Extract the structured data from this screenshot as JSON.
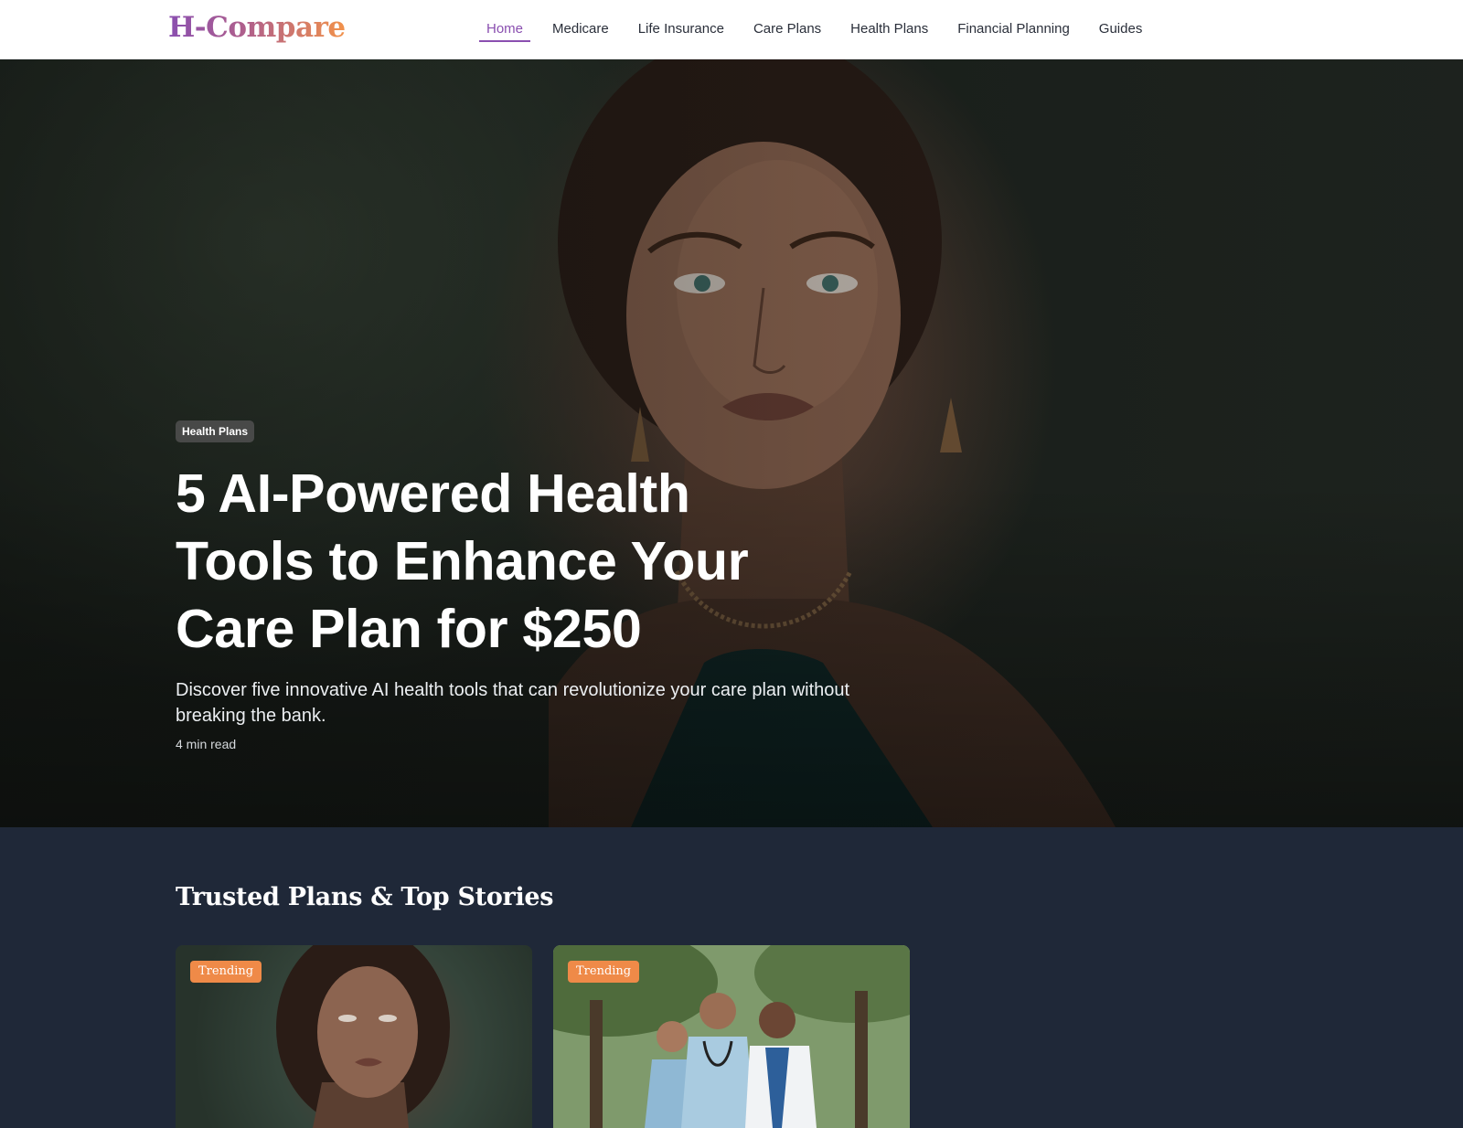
{
  "header": {
    "logo": "H-Compare",
    "nav": [
      {
        "label": "Home",
        "active": true
      },
      {
        "label": "Medicare"
      },
      {
        "label": "Life Insurance"
      },
      {
        "label": "Care Plans"
      },
      {
        "label": "Health Plans"
      },
      {
        "label": "Financial Planning"
      },
      {
        "label": "Guides"
      }
    ]
  },
  "hero": {
    "category": "Health Plans",
    "title": "5 AI-Powered Health Tools to Enhance Your Care Plan for $250",
    "subtitle": "Discover five innovative AI health tools that can revolutionize your care plan without breaking the bank.",
    "read_time": "4 min read"
  },
  "section": {
    "title": "Trusted Plans & Top Stories",
    "cards": [
      {
        "tag": "Trending"
      },
      {
        "tag": "Trending"
      }
    ]
  },
  "colors": {
    "brand_purple": "#8a4fb0",
    "brand_orange": "#f2924a",
    "tag_orange": "#ef8a48",
    "section_bg": "#1f2838"
  }
}
